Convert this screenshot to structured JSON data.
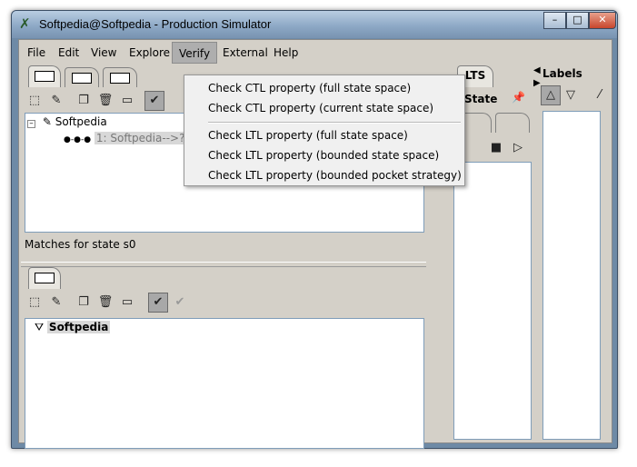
{
  "window": {
    "title": "Softpedia@Softpedia - Production Simulator",
    "controls": {
      "minimize": "–",
      "maximize": "□",
      "close": "✕"
    }
  },
  "menubar": {
    "items": [
      {
        "label": "File"
      },
      {
        "label": "Edit"
      },
      {
        "label": "View"
      },
      {
        "label": "Explore"
      },
      {
        "label": "Verify"
      },
      {
        "label": "External"
      },
      {
        "label": "Help"
      }
    ]
  },
  "verify_menu": {
    "ctl": [
      "Check CTL property (full state space)",
      "Check CTL property (current state space)"
    ],
    "ltl": [
      "Check LTL property (full state space)",
      "Check LTL property (bounded state space)",
      "Check LTL property (bounded pocket strategy)"
    ]
  },
  "top_panel": {
    "tree_root": "Softpedia",
    "tree_child": "1: Softpedia-->?",
    "status": "Matches for state s0"
  },
  "bottom_panel": {
    "tree_root": "Softpedia"
  },
  "middle_panel": {
    "tab_lts": "LTS",
    "tab_state": "State"
  },
  "right_panel": {
    "title": "Labels"
  },
  "icons": {
    "app": "app-logo-icon",
    "pencil": "pencil-icon",
    "check": "check-icon",
    "delete": "trash-icon",
    "copy": "copy-icon"
  }
}
